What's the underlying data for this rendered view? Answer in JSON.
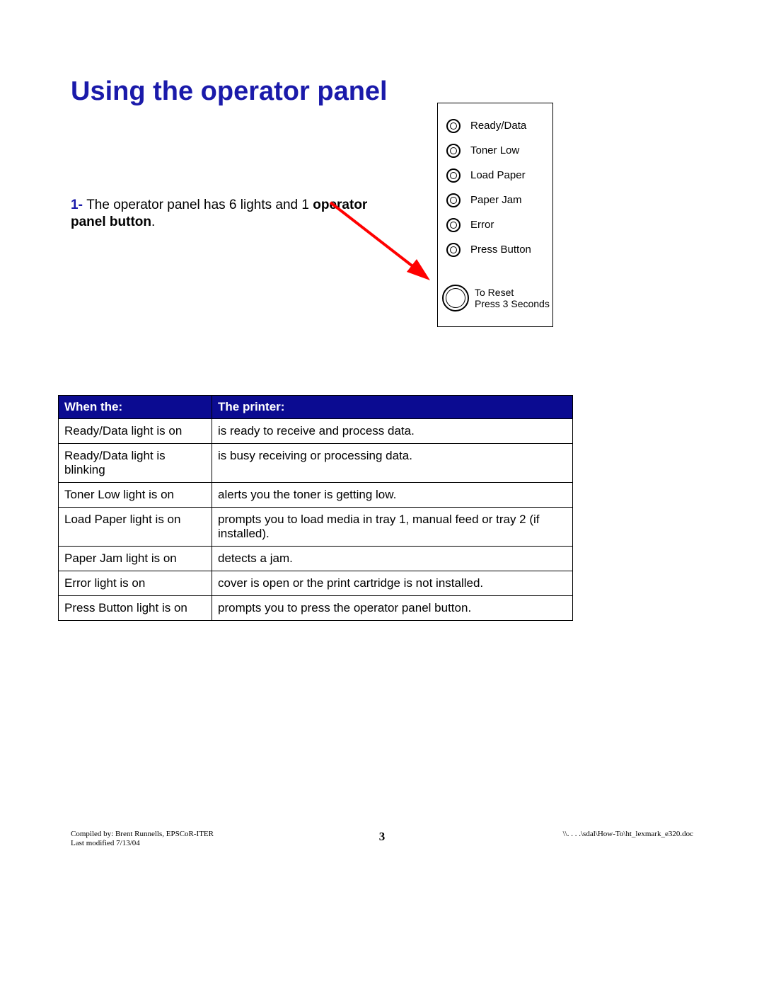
{
  "title": "Using the operator panel",
  "intro": {
    "num": "1- ",
    "part1": "The operator panel has 6 lights and 1 ",
    "bold": "operator panel button",
    "part2": "."
  },
  "panel": {
    "leds": [
      {
        "label": "Ready/Data"
      },
      {
        "label": "Toner Low"
      },
      {
        "label": "Load Paper"
      },
      {
        "label": "Paper Jam"
      },
      {
        "label": "Error"
      },
      {
        "label": "Press Button"
      }
    ],
    "reset_line1": "To Reset",
    "reset_line2": "Press 3 Seconds"
  },
  "table": {
    "header_left": "When the:",
    "header_right": "The printer:",
    "rows": [
      {
        "when": "Ready/Data light is on",
        "printer": "is ready to receive and process data."
      },
      {
        "when": "Ready/Data light is blinking",
        "printer": "is busy receiving or processing data."
      },
      {
        "when": "Toner Low light is on",
        "printer": "alerts you the toner is getting low."
      },
      {
        "when": "Load Paper light is on",
        "printer": "prompts you to load media in tray 1, manual feed or tray 2 (if installed)."
      },
      {
        "when": "Paper Jam light is on",
        "printer": "detects a jam."
      },
      {
        "when": "Error light is on",
        "printer": "cover is open or the print cartridge is not installed."
      },
      {
        "when": "Press Button light is on",
        "printer": "prompts you to press the operator panel button."
      }
    ]
  },
  "footer": {
    "compiled": "Compiled by: Brent Runnells,  EPSCoR-ITER",
    "modified": "Last modified 7/13/04",
    "page": "3",
    "path": "\\\\. . . .\\sdal\\How-To\\ht_lexmark_e320.doc"
  }
}
